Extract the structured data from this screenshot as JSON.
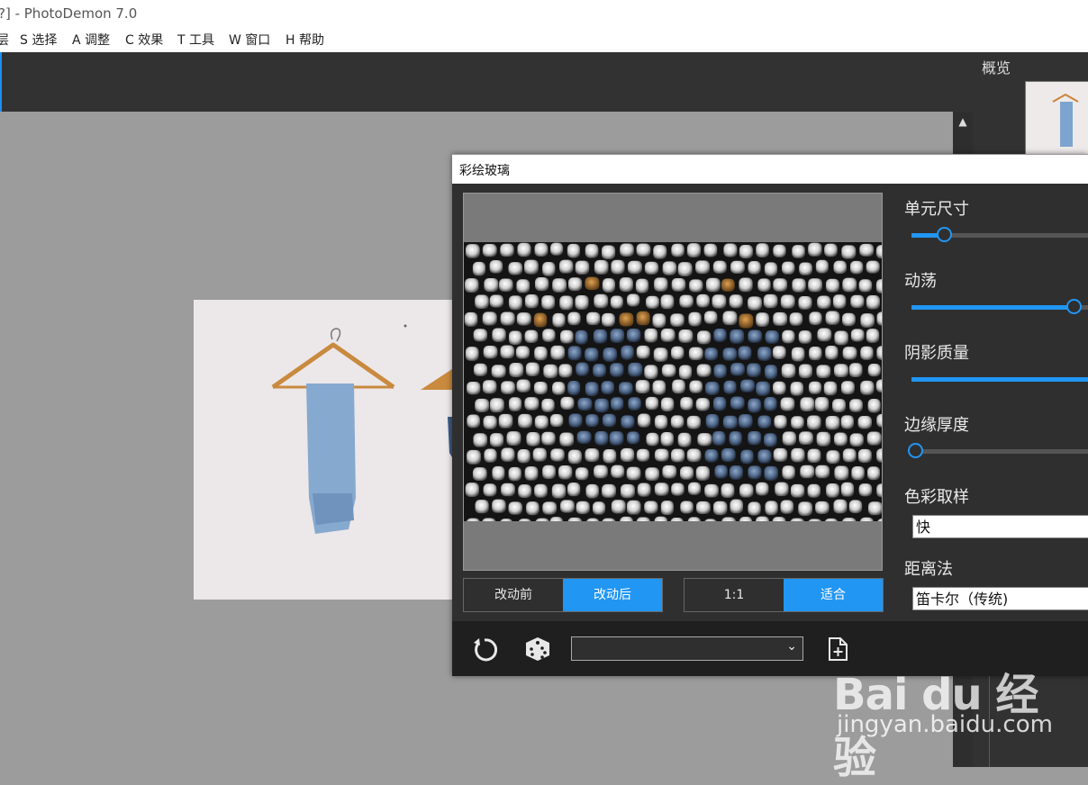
{
  "window": {
    "title": "?]  -  PhotoDemon 7.0"
  },
  "menu": {
    "items": [
      "层",
      "S 选择",
      "A 调整",
      "C 效果",
      "T 工具",
      "W 窗口",
      "H 帮助"
    ]
  },
  "right_panel": {
    "title": "概览"
  },
  "dialog": {
    "title": "彩绘玻璃",
    "view_buttons": {
      "before": "改动前",
      "after": "改动后"
    },
    "zoom_buttons": {
      "one_to_one": "1:1",
      "fit": "适合"
    },
    "controls": {
      "cell_size": {
        "label": "单元尺寸",
        "value_fraction": 0.18
      },
      "turbulence": {
        "label": "动荡",
        "value_fraction": 0.9
      },
      "shade_quality": {
        "label": "阴影质量",
        "value_fraction": 1.0
      },
      "edge_thickness": {
        "label": "边缘厚度",
        "value_fraction": 0.02
      },
      "color_sampling": {
        "label": "色彩取样",
        "value": "快"
      },
      "distance_method": {
        "label": "距离法",
        "value": "笛卡尔（传统)"
      }
    },
    "footer_icons": [
      "reset-icon",
      "dice-icon",
      "chevron-down-icon",
      "add-preset-icon"
    ]
  },
  "watermark": {
    "logo": "Bai du 经验",
    "url": "jingyan.baidu.com"
  },
  "colors": {
    "accent": "#2196f3",
    "panel": "#2f2f2f",
    "canvas": "#9c9c9c"
  }
}
